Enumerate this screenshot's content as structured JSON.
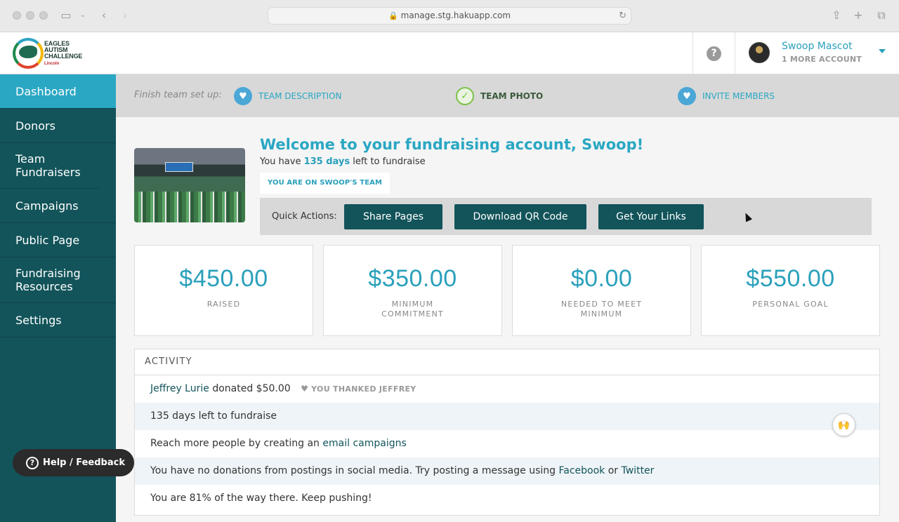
{
  "browser": {
    "url": "manage.stg.hakuapp.com"
  },
  "logo": {
    "line1": "EAGLES",
    "line2": "AUTISM",
    "line3": "CHALLENGE",
    "sponsor": "Lincoln"
  },
  "header": {
    "user_name": "Swoop Mascot",
    "user_sub": "1 MORE ACCOUNT"
  },
  "sidebar": {
    "items": [
      {
        "label": "Dashboard"
      },
      {
        "label": "Donors"
      },
      {
        "label": "Team Fundraisers"
      },
      {
        "label": "Campaigns"
      },
      {
        "label": "Public Page"
      },
      {
        "label": "Fundraising Resources"
      },
      {
        "label": "Settings"
      }
    ],
    "help_label": "Help / Feedback"
  },
  "setup": {
    "label": "Finish team set up:",
    "steps": [
      {
        "label": "TEAM DESCRIPTION",
        "icon": "heart-icon"
      },
      {
        "label": "TEAM PHOTO",
        "icon": "check-icon"
      },
      {
        "label": "INVITE MEMBERS",
        "icon": "heart-icon"
      }
    ]
  },
  "welcome": {
    "title": "Welcome to your fundraising account, Swoop!",
    "days_prefix": "You have ",
    "days_value": "135 days",
    "days_suffix": " left to fundraise",
    "team_badge": "YOU ARE ON SWOOP'S TEAM"
  },
  "quick_actions": {
    "label": "Quick Actions:",
    "buttons": [
      {
        "label": "Share Pages"
      },
      {
        "label": "Download QR Code"
      },
      {
        "label": "Get Your Links"
      }
    ]
  },
  "stats": [
    {
      "value": "$450.00",
      "label": "RAISED"
    },
    {
      "value": "$350.00",
      "label": "MINIMUM COMMITMENT"
    },
    {
      "value": "$0.00",
      "label": "NEEDED TO MEET MINIMUM"
    },
    {
      "value": "$550.00",
      "label": "PERSONAL GOAL"
    }
  ],
  "activity": {
    "header": "ACTIVITY",
    "donor_name": "Jeffrey Lurie",
    "donation_text": " donated $50.00",
    "thanked": "YOU THANKED JEFFREY",
    "days_left": "135 days left to fundraise",
    "email_prefix": "Reach more people by creating an ",
    "email_link": "email campaigns",
    "social_prefix": "You have no donations from postings in social media. Try posting a message using ",
    "facebook_link": "Facebook",
    "social_or": " or ",
    "twitter_link": "Twitter",
    "progress_text": "You are 81% of the way there. Keep pushing!"
  },
  "colors": {
    "accent": "#2aa7c3",
    "sidebar": "#12545a",
    "button": "#12545a"
  }
}
